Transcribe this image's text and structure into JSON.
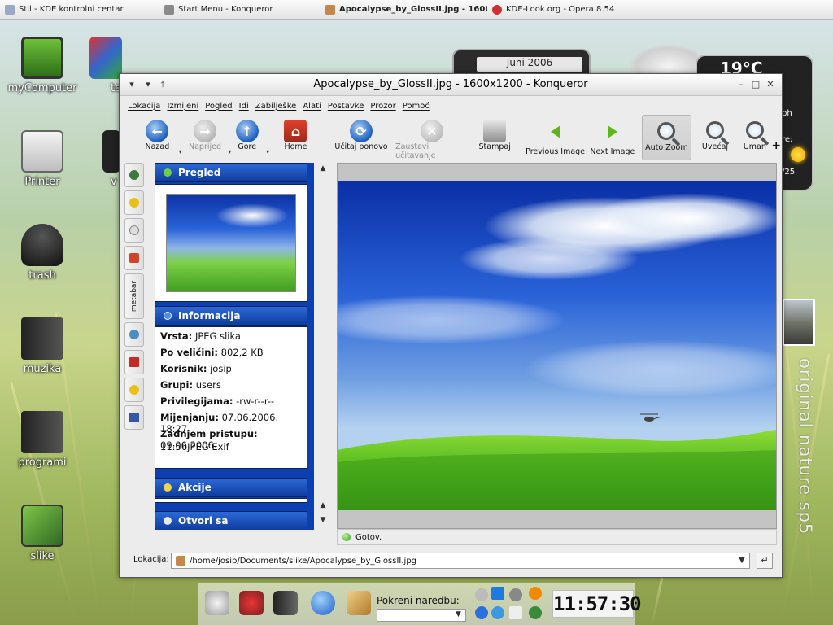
{
  "taskbar": {
    "tasks": [
      {
        "label": "Stil - KDE kontrolni centar",
        "active": false
      },
      {
        "label": "Start Menu - Konqueror",
        "active": false
      },
      {
        "label": "Apocalypse_by_GlossII.jpg - 1600",
        "active": true
      },
      {
        "label": "KDE-Look.org - Opera 8.54",
        "active": false
      }
    ]
  },
  "desktop": {
    "icons": [
      {
        "label": "myComputer"
      },
      {
        "label": "Printer"
      },
      {
        "label": "trash"
      },
      {
        "label": "muzika"
      },
      {
        "label": "programi"
      },
      {
        "label": "slike"
      }
    ],
    "partial_labels": [
      "te",
      "v"
    ]
  },
  "widgets": {
    "calendar_month": "Juni 2006",
    "temperature": "19°C",
    "wind_unit": "ph",
    "prefix": "re:",
    "day": "/25",
    "brand_text": "original nature sp5"
  },
  "window": {
    "title": "Apocalypse_by_GlossII.jpg - 1600x1200 - Konqueror",
    "menu": [
      "Lokacija",
      "Izmijeni",
      "Pogled",
      "Idi",
      "Zabilješke",
      "Alati",
      "Postavke",
      "Prozor",
      "Pomoć"
    ],
    "toolbar": {
      "back": "Nazad",
      "forward": "Naprijed",
      "up": "Gore",
      "home": "Home",
      "reload": "Učitaj ponovo",
      "stop": "Zaustavi učitavanje",
      "print": "Štampaj",
      "prev_image": "Previous Image",
      "next_image": "Next Image",
      "auto_zoom": "Auto Zoom",
      "zoom_in": "Uvećaj",
      "zoom_out": "Uman",
      "more": "+"
    },
    "sidebar_tab_label": "metabar",
    "panel": {
      "preview_title": "Pregled",
      "info_title": "Informacija",
      "actions_title": "Akcije",
      "open_with_title": "Otvori sa",
      "info": [
        {
          "key": "Vrsta:",
          "value": "JPEG slika"
        },
        {
          "key": "Po veličini:",
          "value": "802,2 KB"
        },
        {
          "key": "Korisnik:",
          "value": "josip"
        },
        {
          "key": "Grupi:",
          "value": "users"
        },
        {
          "key": "Privilegijama:",
          "value": "-rw-r--r--"
        },
        {
          "key": "Mijenjanju:",
          "value": "07.06.2006. 18:27"
        },
        {
          "key": "Zadnjem pristupu:",
          "value": "09.06.2006."
        },
        {
          "key": "11:56",
          "value": "JPEG Exif"
        }
      ]
    },
    "status": "Gotov.",
    "location": {
      "label": "Lokacija:",
      "path": "/home/josip/Documents/slike/Apocalypse_by_GlossII.jpg"
    }
  },
  "bottom_panel": {
    "run_command_label": "Pokreni naredbu:",
    "clock": "11:57:30"
  }
}
